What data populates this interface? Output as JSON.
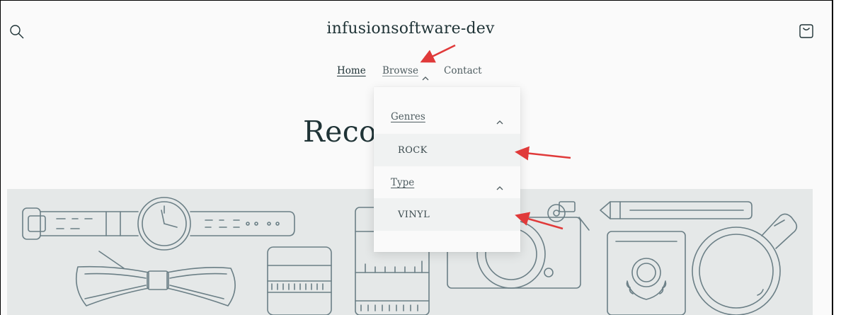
{
  "store": {
    "name": "infusionsoftware-dev"
  },
  "nav": {
    "items": [
      {
        "label": "Home"
      },
      {
        "label": "Browse"
      },
      {
        "label": "Contact"
      }
    ]
  },
  "page": {
    "heading": "Recor"
  },
  "dropdown": {
    "sections": [
      {
        "label": "Genres",
        "items": [
          {
            "label": "ROCK"
          }
        ]
      },
      {
        "label": "Type",
        "items": [
          {
            "label": "VINYL"
          }
        ]
      }
    ]
  },
  "icons": {
    "search": "search-icon",
    "cart": "cart-icon",
    "caret": "chevron-up-icon"
  },
  "colors": {
    "background": "#fafafa",
    "text": "#1f3336",
    "banner": "#e5e8e8",
    "illustration_stroke": "#6b7f86",
    "annotation_arrow": "#e03a3a"
  }
}
